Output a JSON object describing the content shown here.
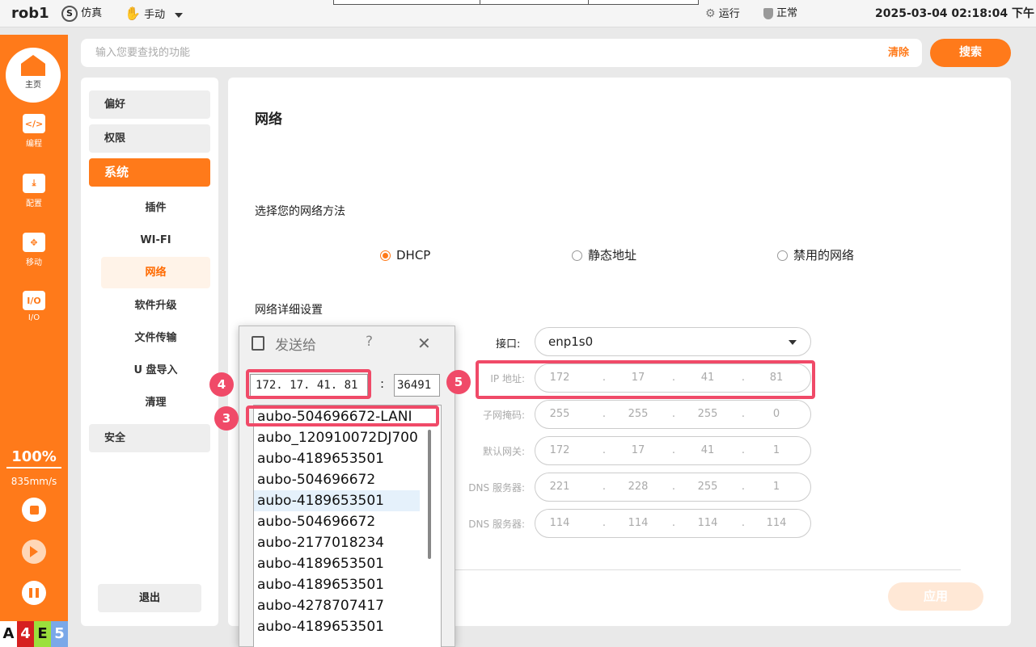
{
  "topbar": {
    "brand": "rob1",
    "mode_sim": "仿真",
    "mode_manual": "手动",
    "run_status": "运行",
    "health_status": "正常",
    "datetime": "2025-03-04 02:18:04 下午"
  },
  "nav": {
    "home": "主页",
    "program": "编程",
    "config": "配置",
    "move": "移动",
    "io": "I/O",
    "io_icon": "I/O",
    "speed_percent": "100%",
    "speed_mm": "835mm/s",
    "status": [
      "A",
      "4",
      "E",
      "5"
    ],
    "status_colors": [
      "#ffffff",
      "#d62020",
      "#9be03c",
      "#7aa8e8"
    ]
  },
  "search": {
    "placeholder": "输入您要查找的功能",
    "clear_label": "清除",
    "search_label": "搜索"
  },
  "menu": {
    "items": [
      "偏好",
      "权限",
      "系统"
    ],
    "sub_items": [
      "插件",
      "WI-FI",
      "网络",
      "软件升级",
      "文件传输",
      "U 盘导入",
      "清理"
    ],
    "security": "安全",
    "logout": "退出"
  },
  "network": {
    "title": "网络",
    "method_label": "选择您的网络方法",
    "methods": [
      "DHCP",
      "静态地址",
      "禁用的网络"
    ],
    "selected_method": "DHCP",
    "detail_label": "网络详细设置",
    "interface_label": "接口:",
    "interface_value": "enp1s0",
    "fields": [
      {
        "label": "IP 地址:",
        "octets": [
          "172",
          "17",
          "41",
          "81"
        ]
      },
      {
        "label": "子网掩码:",
        "octets": [
          "255",
          "255",
          "255",
          "0"
        ]
      },
      {
        "label": "默认网关:",
        "octets": [
          "172",
          "17",
          "41",
          "1"
        ]
      },
      {
        "label": "DNS 服务器:",
        "octets": [
          "221",
          "228",
          "255",
          "1"
        ]
      },
      {
        "label": "DNS 服务器:",
        "octets": [
          "114",
          "114",
          "114",
          "114"
        ]
      }
    ],
    "apply_label": "应用"
  },
  "dialog": {
    "title": "发送给",
    "help": "?",
    "ip": "172. 17. 41. 81",
    "colon": ":",
    "port": "36491",
    "devices": [
      "aubo-504696672-LANI",
      "aubo_120910072DJ700",
      "aubo-4189653501",
      "aubo-504696672",
      "aubo-4189653501",
      "aubo-504696672",
      "aubo-2177018234",
      "aubo-4189653501",
      "aubo-4189653501",
      "aubo-4278707417",
      "aubo-4189653501"
    ]
  },
  "annotations": [
    "4",
    "3",
    "5"
  ]
}
